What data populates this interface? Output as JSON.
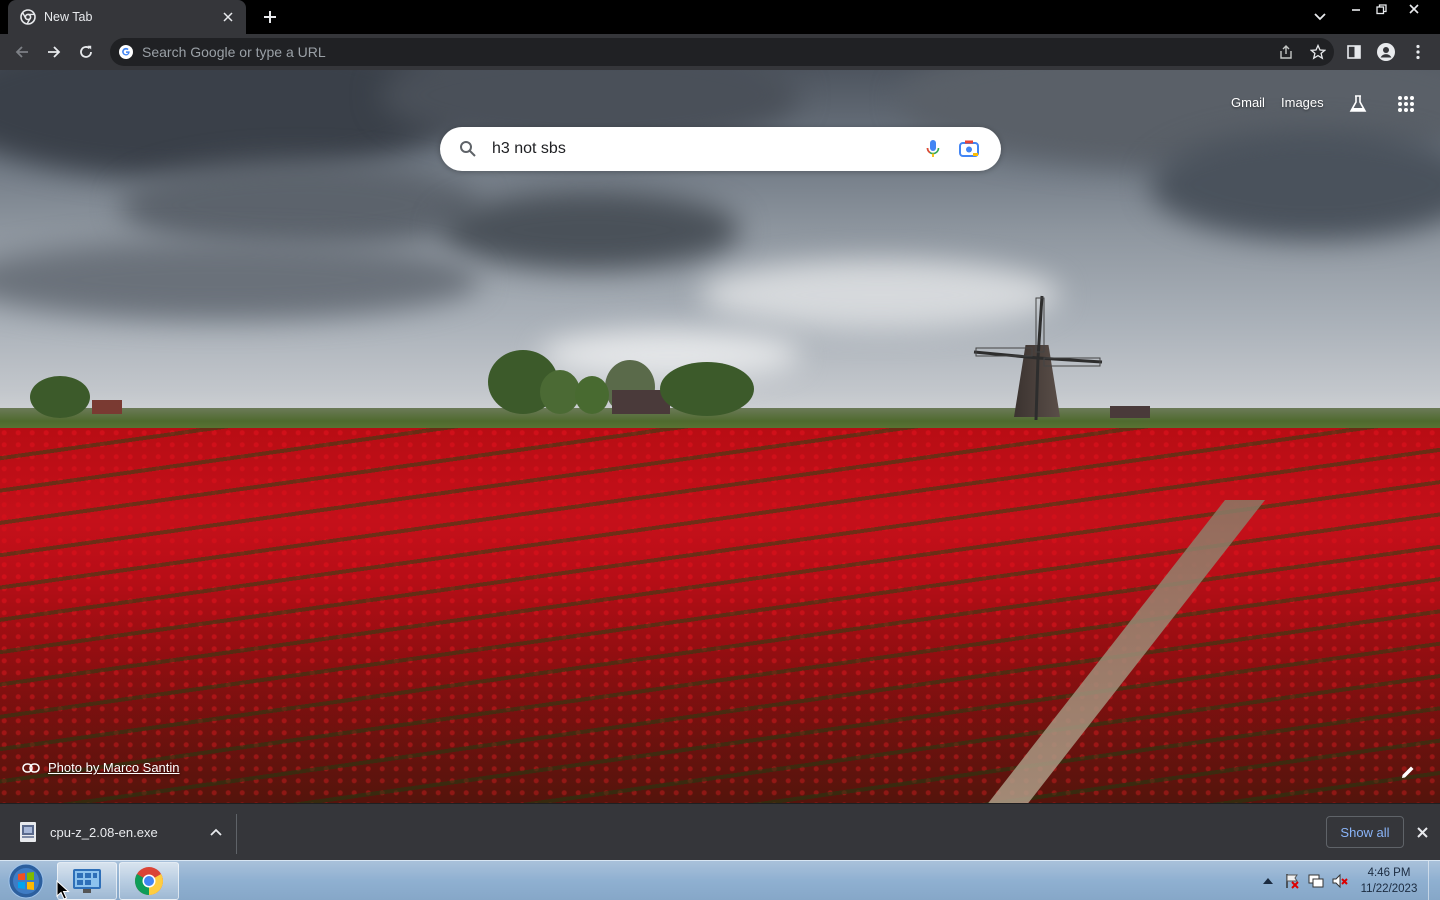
{
  "browser": {
    "tab": {
      "title": "New Tab"
    },
    "omnibox": {
      "placeholder": "Search Google or type a URL"
    }
  },
  "ntp": {
    "links": {
      "gmail": "Gmail",
      "images": "Images"
    },
    "search": {
      "value": "h3 not sbs"
    },
    "attribution": "Photo by Marco Santin"
  },
  "download_shelf": {
    "item": {
      "filename": "cpu-z_2.08-en.exe"
    },
    "show_all": "Show all"
  },
  "taskbar": {
    "clock": {
      "time": "4:46 PM",
      "date": "11/22/2023"
    }
  },
  "colors": {
    "frame": "#000000",
    "toolbar": "#35363a",
    "omnibox": "#202124",
    "link_blue": "#8ab4f8",
    "tulip_red": "#c5101a"
  },
  "icons": {
    "tab": [
      "chrome-favicon-icon",
      "close-icon",
      "plus-icon",
      "chevron-down-icon",
      "minimize-icon",
      "restore-icon",
      "close-window-icon"
    ],
    "toolbar": [
      "back-arrow-icon",
      "forward-arrow-icon",
      "reload-icon",
      "google-g-icon",
      "share-icon",
      "star-icon",
      "side-panel-icon",
      "profile-icon",
      "kebab-menu-icon"
    ],
    "ntp": [
      "flask-icon",
      "apps-grid-icon",
      "search-icon",
      "microphone-icon",
      "camera-icon",
      "link-icon",
      "pencil-icon"
    ],
    "taskbar": [
      "windows-start-icon",
      "control-panel-icon",
      "chrome-icon",
      "up-triangle-icon",
      "flag-icon",
      "network-icon",
      "speaker-muted-icon"
    ]
  }
}
